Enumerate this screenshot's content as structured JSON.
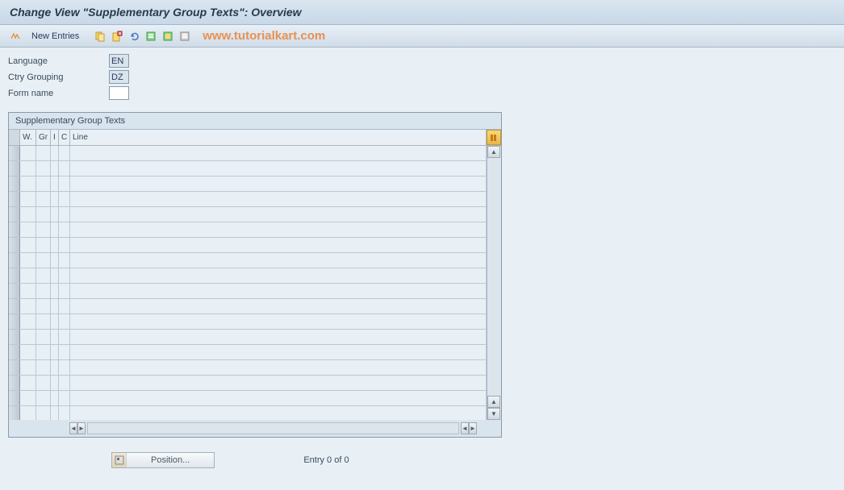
{
  "title": "Change View \"Supplementary Group Texts\": Overview",
  "toolbar": {
    "new_entries_label": "New Entries",
    "watermark": "www.tutorialkart.com"
  },
  "form": {
    "language": {
      "label": "Language",
      "value": "EN"
    },
    "ctry_grouping": {
      "label": "Ctry Grouping",
      "value": "DZ"
    },
    "form_name": {
      "label": "Form name",
      "value": ""
    }
  },
  "table": {
    "title": "Supplementary Group Texts",
    "columns": {
      "w": "W.",
      "gr": "Gr",
      "i": "I",
      "c": "C",
      "line": "Line"
    },
    "row_count": 18
  },
  "footer": {
    "position_label": "Position...",
    "entry_status": "Entry 0 of 0"
  }
}
